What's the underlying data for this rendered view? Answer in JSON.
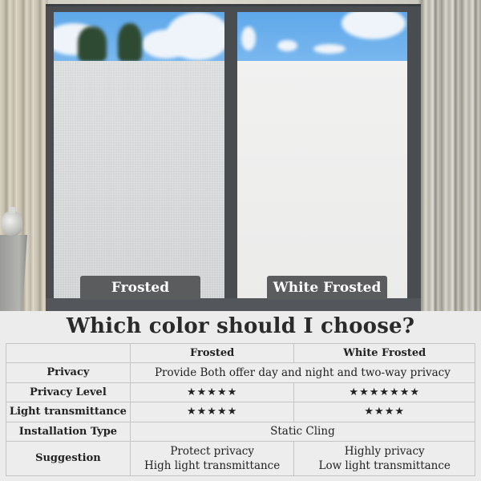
{
  "photo": {
    "labels": {
      "left": "Frosted",
      "right": "White Frosted"
    }
  },
  "heading": "Which color should I choose?",
  "table": {
    "columns": [
      "",
      "Frosted",
      "White Frosted"
    ],
    "rows": {
      "privacy": {
        "label": "Privacy",
        "value": "Provide Both offer day and night and two-way privacy"
      },
      "privacy_level": {
        "label": "Privacy Level",
        "frosted": "★★★★★",
        "white_frosted": "★★★★★★★",
        "frosted_stars": 5,
        "white_frosted_stars": 7
      },
      "light_transmittance": {
        "label": "Light transmittance",
        "frosted": "★★★★★",
        "white_frosted": "★★★★",
        "frosted_stars": 5,
        "white_frosted_stars": 4
      },
      "installation_type": {
        "label": "Installation Type",
        "value": "Static Cling"
      },
      "suggestion": {
        "label": "Suggestion",
        "frosted": [
          "Protect privacy",
          "High light transmittance"
        ],
        "white_frosted": [
          "Highly privacy",
          "Low light transmittance"
        ]
      }
    }
  },
  "colors": {
    "label_bg": "#5b5c5e",
    "frame": "#4a4d50",
    "sky": "#5ea8ea",
    "heading_text": "#2a2a2a",
    "table_bg": "#ededed"
  }
}
